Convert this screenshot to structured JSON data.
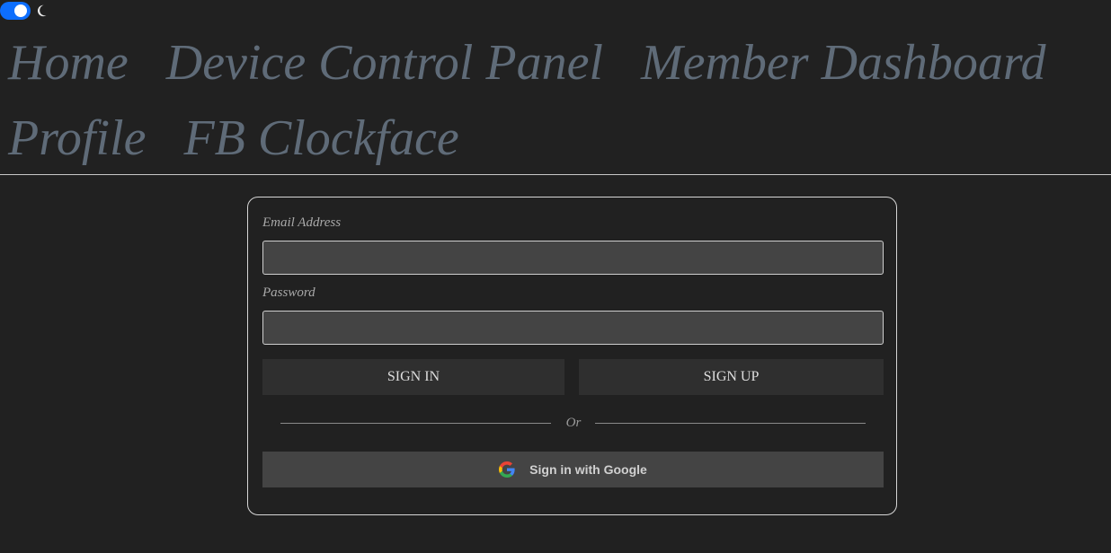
{
  "theme": {
    "toggle_on": true,
    "toggle_color": "#0d6efd",
    "icon": "moon-icon"
  },
  "nav": {
    "items": [
      "Home",
      "Device Control Panel",
      "Member Dashboard",
      "Profile",
      "FB Clockface"
    ]
  },
  "login": {
    "email_label": "Email Address",
    "email_value": "",
    "password_label": "Password",
    "password_value": "",
    "sign_in_label": "SIGN IN",
    "sign_up_label": "SIGN UP",
    "or_label": "Or",
    "google_label": "Sign in with Google",
    "google_icon": "google-logo-icon"
  },
  "colors": {
    "background": "#212121",
    "nav_text": "#5f6b78",
    "input_bg": "#444444",
    "button_bg": "#2f2f2f"
  }
}
